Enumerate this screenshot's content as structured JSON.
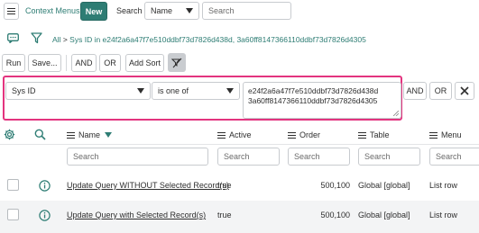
{
  "header": {
    "context_menus_label": "Context Menus",
    "new_label": "New",
    "search_label": "Search",
    "search_field_value": "Name",
    "search_placeholder": "Search"
  },
  "breadcrumb": {
    "all_label": "All",
    "separator": ">",
    "condition": "Sys ID in e24f2a6a47f7e510ddbf73d7826d438d, 3a60ff8147366110ddbf73d7826d4305"
  },
  "toolbar": {
    "run_label": "Run",
    "save_label": "Save...",
    "and_label": "AND",
    "or_label": "OR",
    "add_sort_label": "Add Sort"
  },
  "condition_row": {
    "field_value": "Sys ID",
    "operator_value": "is one of",
    "value_line1": "e24f2a6a47f7e510ddbf73d7826d438d",
    "value_line2": "3a60ff8147366110ddbf73d7826d4305",
    "and_label": "AND",
    "or_label": "OR"
  },
  "columns": [
    {
      "label": "Name",
      "sorted": true
    },
    {
      "label": "Active"
    },
    {
      "label": "Order"
    },
    {
      "label": "Table"
    },
    {
      "label": "Menu"
    }
  ],
  "column_search_placeholder": "Search",
  "rows": [
    {
      "name": "Update Query WITHOUT Selected Record(s)",
      "active": "true",
      "order": "500,100",
      "table": "Global [global]",
      "menu": "List row"
    },
    {
      "name": "Update Query with Selected Record(s)",
      "active": "true",
      "order": "500,100",
      "table": "Global [global]",
      "menu": "List row"
    }
  ],
  "colors": {
    "accent": "#2e7d74",
    "highlight_border": "#e3347f",
    "row_alt": "#f3f4f5"
  }
}
